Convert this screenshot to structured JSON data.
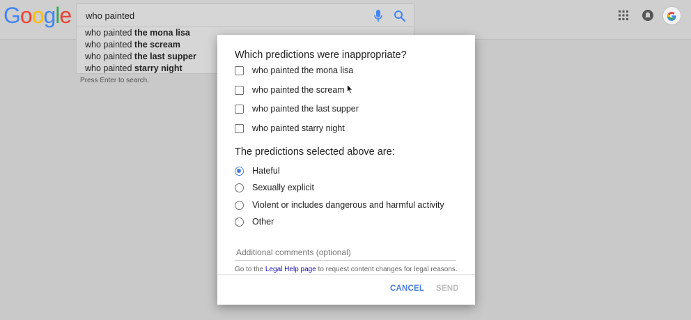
{
  "logo": {
    "letters": [
      "G",
      "o",
      "o",
      "g",
      "l",
      "e"
    ],
    "colors": [
      "#4285f4",
      "#ea4335",
      "#fbbc05",
      "#4285f4",
      "#34a853",
      "#ea4335"
    ]
  },
  "search": {
    "query": "who painted"
  },
  "suggestions": [
    {
      "prefix": "who painted",
      "completion": "the mona lisa"
    },
    {
      "prefix": "who painted",
      "completion": "the scream"
    },
    {
      "prefix": "who painted",
      "completion": "the last supper"
    },
    {
      "prefix": "who painted",
      "completion": "starry night"
    }
  ],
  "press_enter": "Press Enter to search.",
  "header_icons": {
    "apps": "apps-grid-icon",
    "notifications": "notifications-icon",
    "account": "google-account-icon"
  },
  "dialog": {
    "question_predictions": "Which predictions were inappropriate?",
    "predictions": [
      {
        "label": "who painted the mona lisa",
        "checked": false
      },
      {
        "label": "who painted the scream",
        "checked": false
      },
      {
        "label": "who painted the last supper",
        "checked": false
      },
      {
        "label": "who painted starry night",
        "checked": false
      }
    ],
    "question_reason": "The predictions selected above are:",
    "reasons": [
      {
        "label": "Hateful",
        "selected": true
      },
      {
        "label": "Sexually explicit",
        "selected": false
      },
      {
        "label": "Violent or includes dangerous and harmful activity",
        "selected": false
      },
      {
        "label": "Other",
        "selected": false
      }
    ],
    "comments_placeholder": "Additional comments (optional)",
    "legal_prefix": "Go to the",
    "legal_link": "Legal Help page",
    "legal_suffix": "to request content changes for legal reasons.",
    "cancel_label": "CANCEL",
    "send_label": "SEND"
  },
  "colors": {
    "accent": "#4a7fd8",
    "disabled": "#bdbdbd",
    "overlay_bg": "#c9c9c9"
  }
}
